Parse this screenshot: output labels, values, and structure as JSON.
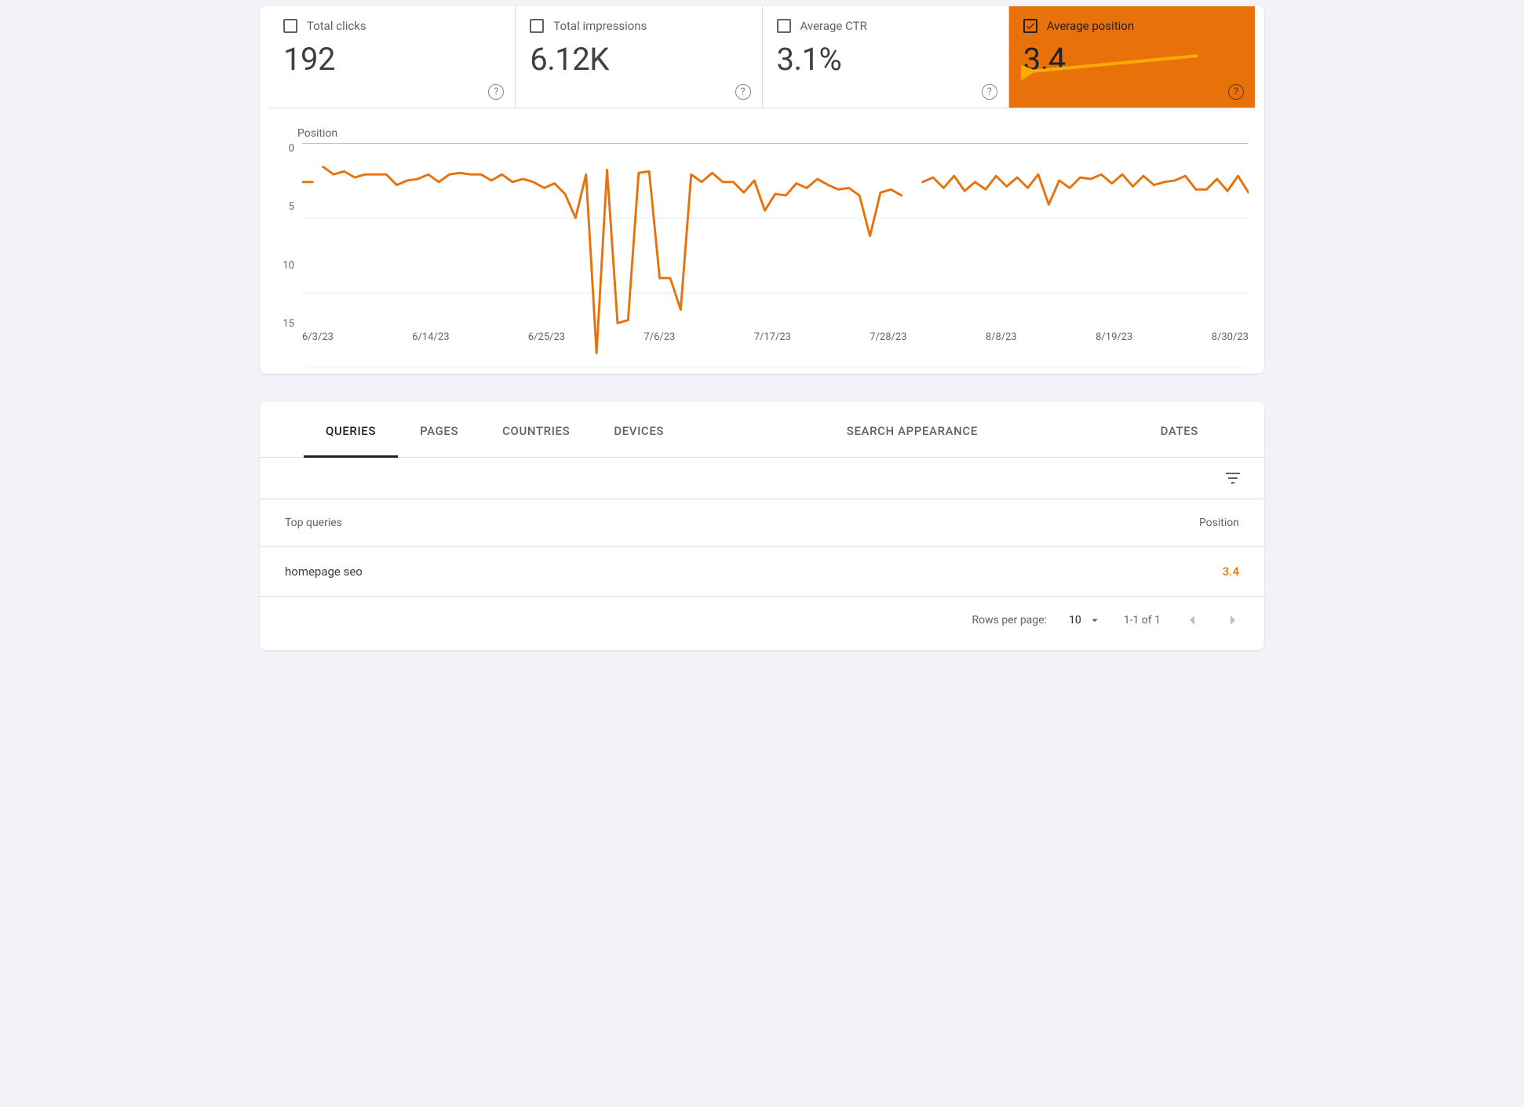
{
  "colors": {
    "accent": "#E8710A",
    "arrow": "#F9AB00"
  },
  "metrics": [
    {
      "id": "total-clicks",
      "label": "Total clicks",
      "value": "192",
      "checked": false,
      "active": false
    },
    {
      "id": "total-impressions",
      "label": "Total impressions",
      "value": "6.12K",
      "checked": false,
      "active": false
    },
    {
      "id": "average-ctr",
      "label": "Average CTR",
      "value": "3.1%",
      "checked": false,
      "active": false
    },
    {
      "id": "average-position",
      "label": "Average position",
      "value": "3.4",
      "checked": true,
      "active": true
    }
  ],
  "chart": {
    "title": "Position",
    "y_ticks": [
      "0",
      "5",
      "10",
      "15"
    ],
    "x_ticks": [
      "6/3/23",
      "6/14/23",
      "6/25/23",
      "7/6/23",
      "7/17/23",
      "7/28/23",
      "8/8/23",
      "8/19/23",
      "8/30/23"
    ]
  },
  "chart_data": {
    "type": "line",
    "title": "Position",
    "ylabel": "Position",
    "xlabel": "",
    "ylim": [
      15,
      0
    ],
    "x_tick_labels": [
      "6/3/23",
      "6/14/23",
      "6/25/23",
      "7/6/23",
      "7/17/23",
      "7/28/23",
      "8/8/23",
      "8/19/23",
      "8/30/23"
    ],
    "series": [
      {
        "name": "Average position",
        "color": "#E8710A",
        "segments": [
          {
            "x": [
              0,
              1
            ],
            "y": [
              2.6,
              2.6
            ]
          },
          {
            "x": [
              2,
              3,
              4,
              5,
              6,
              7,
              8,
              9,
              10,
              11,
              12,
              13,
              14,
              15,
              16,
              17,
              18,
              19,
              20,
              21,
              22,
              23,
              24,
              25,
              26,
              27,
              28,
              29,
              30,
              31,
              32,
              33,
              34,
              35,
              36,
              37,
              38,
              39,
              40,
              41,
              42,
              43,
              44,
              45,
              46,
              47,
              48,
              49,
              50,
              51,
              52,
              53,
              54,
              55,
              56,
              57
            ],
            "y": [
              1.6,
              2.1,
              1.9,
              2.3,
              2.1,
              2.1,
              2.1,
              2.8,
              2.5,
              2.4,
              2.1,
              2.6,
              2.1,
              2.0,
              2.1,
              2.1,
              2.5,
              2.1,
              2.6,
              2.4,
              2.6,
              3.0,
              2.7,
              3.4,
              5.0,
              2.1,
              14.0,
              1.8,
              12.0,
              11.8,
              2.0,
              1.9,
              9.0,
              9.0,
              11.1,
              2.1,
              2.6,
              2.0,
              2.6,
              2.6,
              3.3,
              2.5,
              4.5,
              3.4,
              3.5,
              2.7,
              3.0,
              2.4,
              2.8,
              3.1,
              3.0,
              3.5,
              6.2,
              3.3,
              3.1,
              3.5
            ]
          },
          {
            "x": [
              59,
              60,
              61,
              62,
              63,
              64,
              65,
              66,
              67,
              68,
              69,
              70,
              71,
              72,
              73,
              74,
              75,
              76,
              77,
              78,
              79,
              80,
              81,
              82,
              83,
              84,
              85,
              86,
              87,
              88,
              89,
              90
            ],
            "y": [
              2.6,
              2.3,
              3.0,
              2.2,
              3.2,
              2.6,
              3.1,
              2.2,
              2.9,
              2.3,
              3.0,
              2.1,
              4.1,
              2.5,
              3.0,
              2.3,
              2.4,
              2.1,
              2.7,
              2.1,
              2.9,
              2.2,
              2.8,
              2.6,
              2.5,
              2.2,
              3.1,
              3.1,
              2.4,
              3.2,
              2.2,
              3.3
            ]
          }
        ]
      }
    ]
  },
  "tabs": [
    "QUERIES",
    "PAGES",
    "COUNTRIES",
    "DEVICES",
    "SEARCH APPEARANCE",
    "DATES"
  ],
  "active_tab": 0,
  "table": {
    "header_left": "Top queries",
    "header_right": "Position",
    "rows": [
      {
        "query": "homepage seo",
        "position": "3.4"
      }
    ]
  },
  "pager": {
    "rows_label": "Rows per page:",
    "rows_value": "10",
    "range": "1-1 of 1"
  }
}
